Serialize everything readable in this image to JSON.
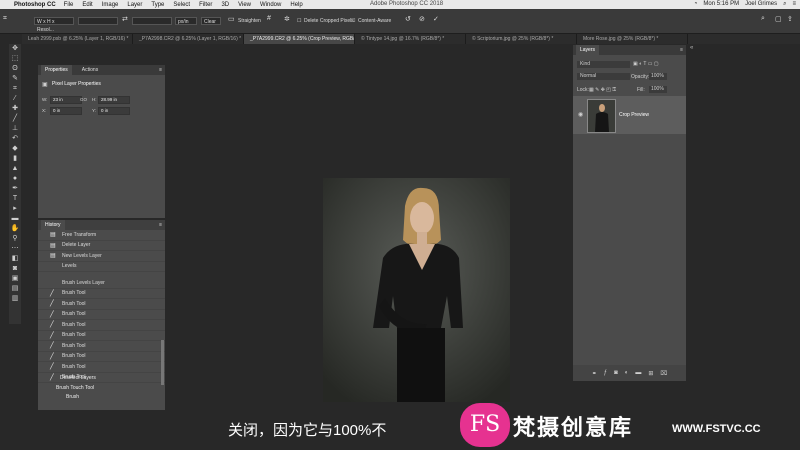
{
  "menubar": {
    "app": "Photoshop CC",
    "items": [
      "File",
      "Edit",
      "Image",
      "Layer",
      "Type",
      "Select",
      "Filter",
      "3D",
      "View",
      "Window",
      "Help"
    ],
    "title": "Adobe Photoshop CC 2018",
    "clock": "Mon 5:16 PM",
    "user": "Joel Grimes"
  },
  "options": {
    "ratio": "W x H x Resol...",
    "unit": "px/in",
    "clear": "Clear",
    "straighten": "Straighten",
    "delete_cropped": "Delete Cropped Pixels",
    "content_aware": "Content-Aware"
  },
  "tabs": [
    "Leah 2999.psb @ 6.25% (Layer 1, RGB/16) *",
    "_P7A2998.CR2 @ 6.25% (Layer 1, RGB/16) *",
    "_P7A2999.CR2 @ 6.25% (Crop Preview, RGB/8) *",
    "© Tintype 14.jpg @ 16.7% (RGB/8*) *",
    "© Scriptorium.jpg @ 25% (RGB/8*) *",
    "More Rose.jpg @ 25% (RGB/8*) *"
  ],
  "properties": {
    "tab_active": "Properties",
    "tab_other": "Actions",
    "section": "Pixel Layer Properties",
    "w_label": "W:",
    "w_value": "23 in",
    "go_label": "GO",
    "h_label": "H:",
    "h_value": "28.99 in",
    "x_label": "X:",
    "x_value": "0 in",
    "y_label": "Y:",
    "y_value": "0 in"
  },
  "history": {
    "title": "History",
    "items": [
      "Free Transform",
      "Delete Layer",
      "New Levels Layer",
      "Levels",
      "Brush Levels Layer",
      "Brush Tool",
      "Brush Tool",
      "Brush Tool",
      "Brush Tool",
      "Brush Tool",
      "Brush Tool",
      "Brush Tool",
      "Brush Tool",
      "Brush Tool"
    ],
    "overlay1": "Deselect Layers",
    "overlay2": "Brush Touch Tool",
    "overlay3": "Brush"
  },
  "layers": {
    "title": "Layers",
    "kind": "Kind",
    "blend": "Normal",
    "opacity_label": "Opacity:",
    "opacity": "100%",
    "lock_label": "Lock:",
    "fill_label": "Fill:",
    "fill": "100%",
    "layer_name": "Crop Preview"
  },
  "overlay": {
    "subtitle": "关闭，因为它与100%不",
    "logo_letters": "FS",
    "brand": "梵摄创意库",
    "url": "WWW.FSTVC.CC"
  },
  "colors": {
    "accent": "#e63290",
    "panel": "#4b4b4b",
    "workspace": "#282828"
  }
}
